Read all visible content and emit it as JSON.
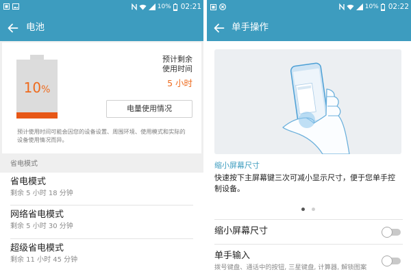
{
  "left": {
    "status_bar": {
      "battery_text": "10%",
      "time": "02:21"
    },
    "app_bar": {
      "title": "电池"
    },
    "battery": {
      "value": "10",
      "unit": "%",
      "level": 0.1
    },
    "estimate": {
      "line1": "预计剩余",
      "line2": "使用时间",
      "value": "5 小时"
    },
    "usage_button_label": "电量使用情况",
    "disclaimer": "预计使用时间可能会因您的设备设置、周围环境、使用模式和实际的设备使用情况而异。",
    "section_header": "省电模式",
    "modes": [
      {
        "title": "省电模式",
        "subtitle": "剩余 5 小时 18 分钟"
      },
      {
        "title": "网络省电模式",
        "subtitle": "剩余 5 小时 30 分钟"
      },
      {
        "title": "超级省电模式",
        "subtitle": "剩余 11 小时 45 分钟"
      }
    ]
  },
  "right": {
    "status_bar": {
      "battery_text": "10%",
      "time": "02:22"
    },
    "app_bar": {
      "title": "单手操作"
    },
    "feature": {
      "title": "缩小屏幕尺寸",
      "description": "快速按下主屏幕键三次可减小显示尺寸，便于您单手控制设备。"
    },
    "pager": {
      "count": 2,
      "active_index": 0
    },
    "settings": [
      {
        "title": "缩小屏幕尺寸",
        "enabled": false
      },
      {
        "title": "单手输入",
        "subtitle": "拨号键盘、通话中的按钮, 三星键盘, 计算器, 解锁图案",
        "enabled": false
      }
    ]
  },
  "colors": {
    "header_bar": "#3d9cbf",
    "battery_orange": "#ee6a1c",
    "battery_fill": "#e75716",
    "feature_title": "#3d9cbf"
  },
  "icons": {
    "left_status": [
      "screenshot-notification-icon",
      "image-icon"
    ],
    "right_status": [
      "screenshot-notification-icon",
      "circle-x-icon"
    ],
    "system_status": [
      "nfc-icon",
      "wifi-icon",
      "signal-icon",
      "battery-status-icon"
    ],
    "navigation": "arrow-left-icon"
  }
}
